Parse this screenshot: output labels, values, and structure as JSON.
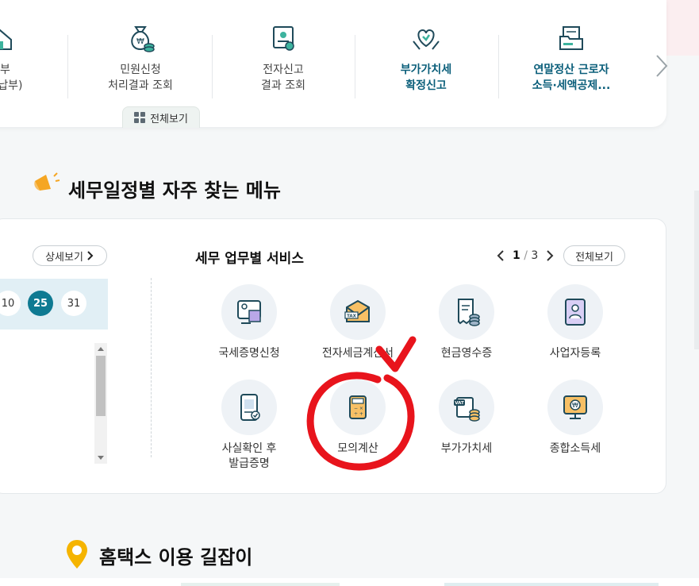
{
  "quick_menu": {
    "items": [
      {
        "label": "납부\n조회납부)",
        "icon": "house-tax-icon",
        "bold": false
      },
      {
        "label": "민원신청\n처리결과 조회",
        "icon": "money-bag-icon",
        "bold": false
      },
      {
        "label": "전자신고\n결과 조회",
        "icon": "certificate-icon",
        "bold": false
      },
      {
        "label": "부가가치세\n확정신고",
        "icon": "heart-hands-icon",
        "bold": true
      },
      {
        "label": "연말정산 근로자\n소득·세액공제...",
        "icon": "folder-document-icon",
        "bold": true
      }
    ],
    "view_all": "전체보기"
  },
  "schedule_section": {
    "title": "세무일정별 자주 찾는 메뉴",
    "detail_button": "상세보기",
    "days": [
      "10",
      "25",
      "31"
    ],
    "active_day": "25"
  },
  "services": {
    "title": "세무 업무별 서비스",
    "page_current": "1",
    "page_separator": "/",
    "page_total": "3",
    "view_all": "전체보기",
    "items": [
      {
        "label": "국세증명신청",
        "icon": "certificate-screen-icon"
      },
      {
        "label": "전자세금계산서",
        "icon": "tax-envelope-icon"
      },
      {
        "label": "현금영수증",
        "icon": "receipt-coins-icon"
      },
      {
        "label": "사업자등록",
        "icon": "business-registration-icon"
      },
      {
        "label": "사실확인 후\n발급증명",
        "icon": "phone-document-icon"
      },
      {
        "label": "모의계산",
        "icon": "calculator-icon"
      },
      {
        "label": "부가가치세",
        "icon": "vat-coins-icon"
      },
      {
        "label": "종합소득세",
        "icon": "monitor-won-icon"
      }
    ]
  },
  "guide_section": {
    "title": "홈택스 이용 길잡이"
  },
  "colors": {
    "accent": "#0f7a92",
    "annotation": "#e8141c"
  }
}
